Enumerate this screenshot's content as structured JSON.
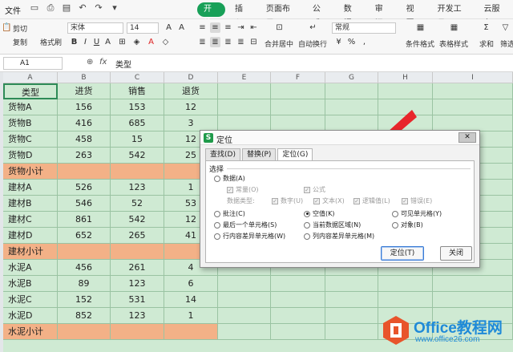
{
  "menu": {
    "file_label": "文件",
    "qa_icons": [
      "save-icon",
      "print-icon",
      "preview-icon",
      "undo-icon",
      "redo-icon",
      "dropdown-icon"
    ]
  },
  "tabs": [
    "开始",
    "插入",
    "页面布局",
    "公式",
    "数据",
    "审阅",
    "视图",
    "开发工具",
    "云服务"
  ],
  "active_tab": "开始",
  "accent_color": "#18a058",
  "ribbon": {
    "cut": "剪切",
    "copy": "复制",
    "format_painter": "格式刷",
    "font_name": "宋体",
    "font_size": "14",
    "merge_center": "合并居中",
    "wrap": "自动换行",
    "number_format": "常规",
    "cond_format": "条件格式",
    "table_style": "表格样式",
    "sum": "求和",
    "filter": "筛选"
  },
  "formula_bar": {
    "name_box": "A1",
    "fx": "fx",
    "content": "类型"
  },
  "columns": [
    "A",
    "B",
    "C",
    "D",
    "E",
    "F",
    "G",
    "H",
    "I"
  ],
  "sheet": {
    "header": [
      "类型",
      "进货",
      "销售",
      "退货"
    ],
    "rows": [
      {
        "cells": [
          "货物A",
          "156",
          "153",
          "12"
        ],
        "highlight": false
      },
      {
        "cells": [
          "货物B",
          "416",
          "685",
          "3"
        ],
        "highlight": false
      },
      {
        "cells": [
          "货物C",
          "458",
          "15",
          "12"
        ],
        "highlight": false
      },
      {
        "cells": [
          "货物D",
          "263",
          "542",
          "25"
        ],
        "highlight": false
      },
      {
        "cells": [
          "货物小计",
          "",
          "",
          ""
        ],
        "highlight": true
      },
      {
        "cells": [
          "建材A",
          "526",
          "123",
          "1"
        ],
        "highlight": false
      },
      {
        "cells": [
          "建材B",
          "546",
          "52",
          "53"
        ],
        "highlight": false
      },
      {
        "cells": [
          "建材C",
          "861",
          "542",
          "12"
        ],
        "highlight": false
      },
      {
        "cells": [
          "建材D",
          "652",
          "265",
          "41"
        ],
        "highlight": false
      },
      {
        "cells": [
          "建材小计",
          "",
          "",
          ""
        ],
        "highlight": true
      },
      {
        "cells": [
          "水泥A",
          "456",
          "261",
          "4"
        ],
        "highlight": false
      },
      {
        "cells": [
          "水泥B",
          "89",
          "123",
          "6"
        ],
        "highlight": false
      },
      {
        "cells": [
          "水泥C",
          "152",
          "531",
          "14"
        ],
        "highlight": false
      },
      {
        "cells": [
          "水泥D",
          "852",
          "123",
          "1"
        ],
        "highlight": false
      },
      {
        "cells": [
          "水泥小计",
          "",
          "",
          ""
        ],
        "highlight": true
      }
    ]
  },
  "dialog": {
    "title": "定位",
    "close": "✕",
    "tabs": [
      "查找(D)",
      "替换(P)",
      "定位(G)"
    ],
    "active_tab": "定位(G)",
    "group_label": "选择",
    "data_label": "数据(A)",
    "const_label": "常量(O)",
    "formula_label": "公式",
    "data_type_label": "数据类型:",
    "types": [
      "数字(U)",
      "文本(X)",
      "逻辑值(L)",
      "错误(E)"
    ],
    "options": [
      [
        "批注(C)",
        "空值(K)",
        "可见单元格(Y)"
      ],
      [
        "最后一个单元格(S)",
        "当前数据区域(N)",
        "对象(B)"
      ],
      [
        "行内容差异单元格(W)",
        "列内容差异单元格(M)",
        ""
      ]
    ],
    "selected_option": "空值(K)",
    "ok": "定位(T)",
    "cancel": "关闭"
  },
  "watermark": {
    "line1": "Office教程网",
    "line2": "www.office26.com"
  }
}
